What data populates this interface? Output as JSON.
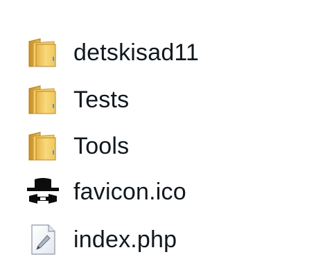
{
  "explorer": {
    "items": [
      {
        "name": "detskisad11",
        "type": "folder",
        "icon": "folder-icon"
      },
      {
        "name": "Tests",
        "type": "folder",
        "icon": "folder-icon"
      },
      {
        "name": "Tools",
        "type": "folder",
        "icon": "folder-icon"
      },
      {
        "name": "favicon.ico",
        "type": "ico",
        "icon": "spy-hat-icon"
      },
      {
        "name": "index.php",
        "type": "php",
        "icon": "php-file-icon"
      }
    ],
    "colors": {
      "folder_front": "#f2c95e",
      "folder_back": "#d9a43a",
      "text": "#10181f"
    }
  }
}
